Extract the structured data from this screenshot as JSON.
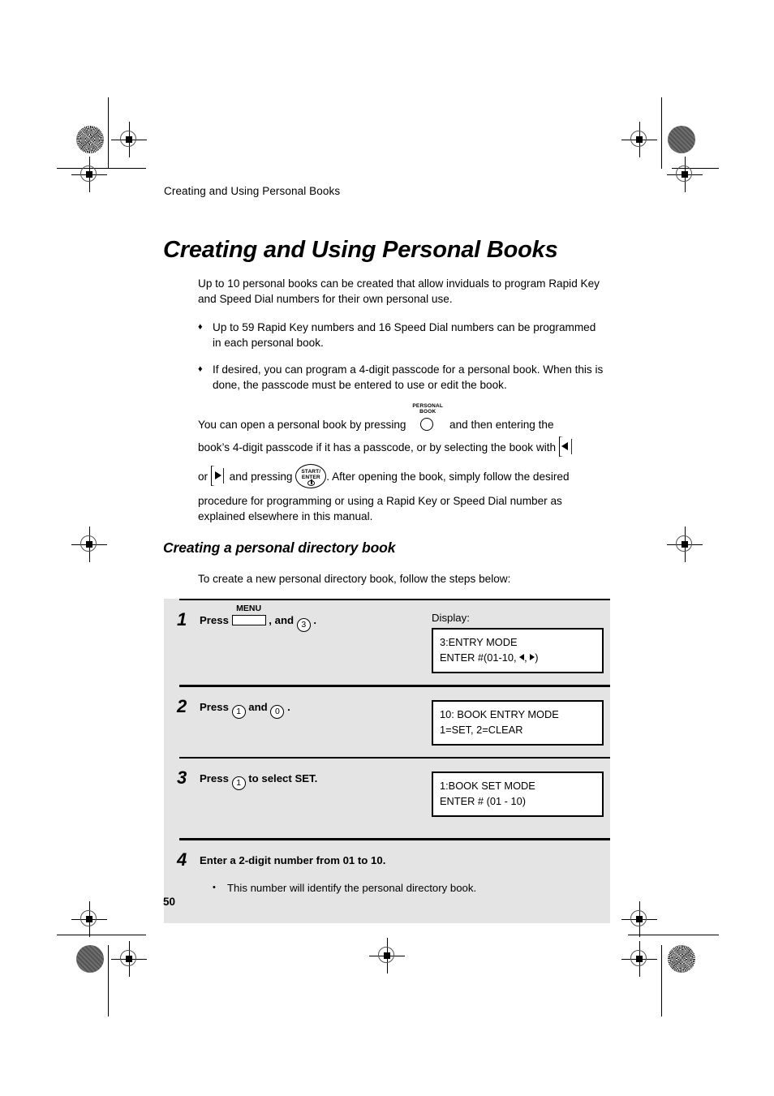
{
  "page": {
    "running_head": "Creating and Using Personal Books",
    "chapter_title": "Creating and Using Personal Books",
    "page_number": "50"
  },
  "intro": {
    "paragraph": "Up to 10 personal books can be created that allow inviduals to program Rapid Key and Speed Dial numbers for their own personal use.",
    "bullets": [
      "Up to 59 Rapid Key numbers and 16 Speed Dial numbers can be programmed in each personal book.",
      "If desired, you can program a 4-digit passcode for a personal book. When this is done, the passcode must be entered to use or edit the book."
    ],
    "bullet_marker": "♦"
  },
  "flow": {
    "line1_a": "You can open a personal book by pressing",
    "line1_b": "and then entering the",
    "line2_a": "book’s 4-digit passcode if it has a passcode, or by selecting the book with",
    "line3_a": "or",
    "line3_b": "and pressing",
    "line3_c": ". After opening the book, simply follow the desired",
    "tail": "procedure for programming or using a Rapid Key or Speed Dial number as explained elsewhere in this manual."
  },
  "keys": {
    "personal_book_line1": "PERSONAL",
    "personal_book_line2": "BOOK",
    "start_enter_line1": "START/",
    "start_enter_line2": "ENTER",
    "menu_label": "MENU"
  },
  "section": {
    "title": "Creating a personal directory book",
    "intro": "To create a new personal directory book, follow the steps below:"
  },
  "steps": [
    {
      "number": "1",
      "text_a": "Press",
      "text_b": ", and",
      "text_c": ".",
      "digits": [
        "3"
      ],
      "display_label": "Display:",
      "lcd_line1": "3:ENTRY MODE",
      "lcd_line2_a": "ENTER #(01-10,",
      "lcd_line2_b": ",",
      "lcd_line2_c": ")"
    },
    {
      "number": "2",
      "text_a": "Press",
      "text_b": "and",
      "text_c": ".",
      "digits": [
        "1",
        "0"
      ],
      "lcd_line1": "10: BOOK ENTRY MODE",
      "lcd_line2": "1=SET, 2=CLEAR"
    },
    {
      "number": "3",
      "text_a": "Press",
      "text_b": "to select SET.",
      "digits": [
        "1"
      ],
      "lcd_line1": "1:BOOK SET MODE",
      "lcd_line2": "ENTER # (01 - 10)"
    },
    {
      "number": "4",
      "text": "Enter a 2-digit number from 01 to 10.",
      "sub_bullet": "This number will identify the personal directory book.",
      "sub_bullet_marker": "•"
    }
  ]
}
